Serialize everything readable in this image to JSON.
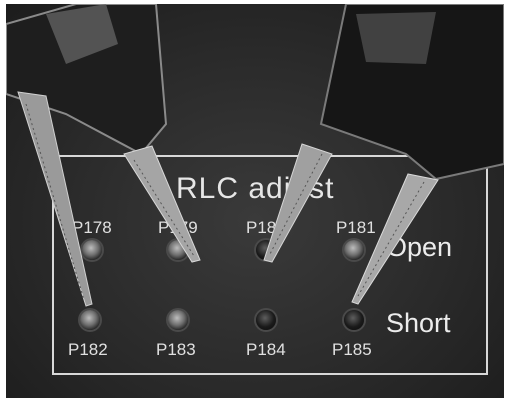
{
  "board": {
    "title": "RLC adjust",
    "rows": {
      "open_label": "Open",
      "short_label": "Short"
    },
    "open_pads": [
      "P178",
      "P179",
      "P180",
      "P181"
    ],
    "short_pads": [
      "P182",
      "P183",
      "P184",
      "P185"
    ]
  }
}
